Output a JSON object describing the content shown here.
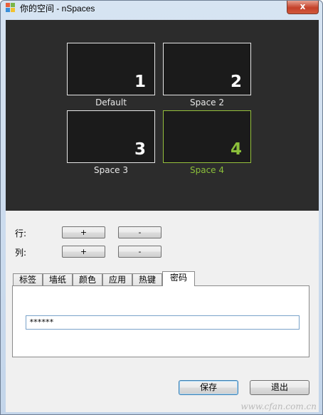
{
  "window": {
    "title": "你的空间 - nSpaces",
    "close_label": "x",
    "icon": "app-logo-icon"
  },
  "spaces": [
    {
      "number": "1",
      "label": "Default",
      "active": false
    },
    {
      "number": "2",
      "label": "Space 2",
      "active": false
    },
    {
      "number": "3",
      "label": "Space 3",
      "active": false
    },
    {
      "number": "4",
      "label": "Space 4",
      "active": true
    }
  ],
  "grid_controls": {
    "rows_label": "行:",
    "cols_label": "列:",
    "plus": "+",
    "minus": "-"
  },
  "tabs": [
    {
      "label": "标签",
      "active": false
    },
    {
      "label": "墙纸",
      "active": false
    },
    {
      "label": "颜色",
      "active": false
    },
    {
      "label": "应用",
      "active": false
    },
    {
      "label": "热键",
      "active": false
    },
    {
      "label": "密码",
      "active": true
    }
  ],
  "password": {
    "value": "******"
  },
  "footer": {
    "save_label": "保存",
    "exit_label": "退出"
  },
  "watermark": "www.cfan.com.cn",
  "colors": {
    "panel_bg": "#2c2c2c",
    "tile_bg": "#1b1b1b",
    "active_accent": "#8bbf3a"
  }
}
